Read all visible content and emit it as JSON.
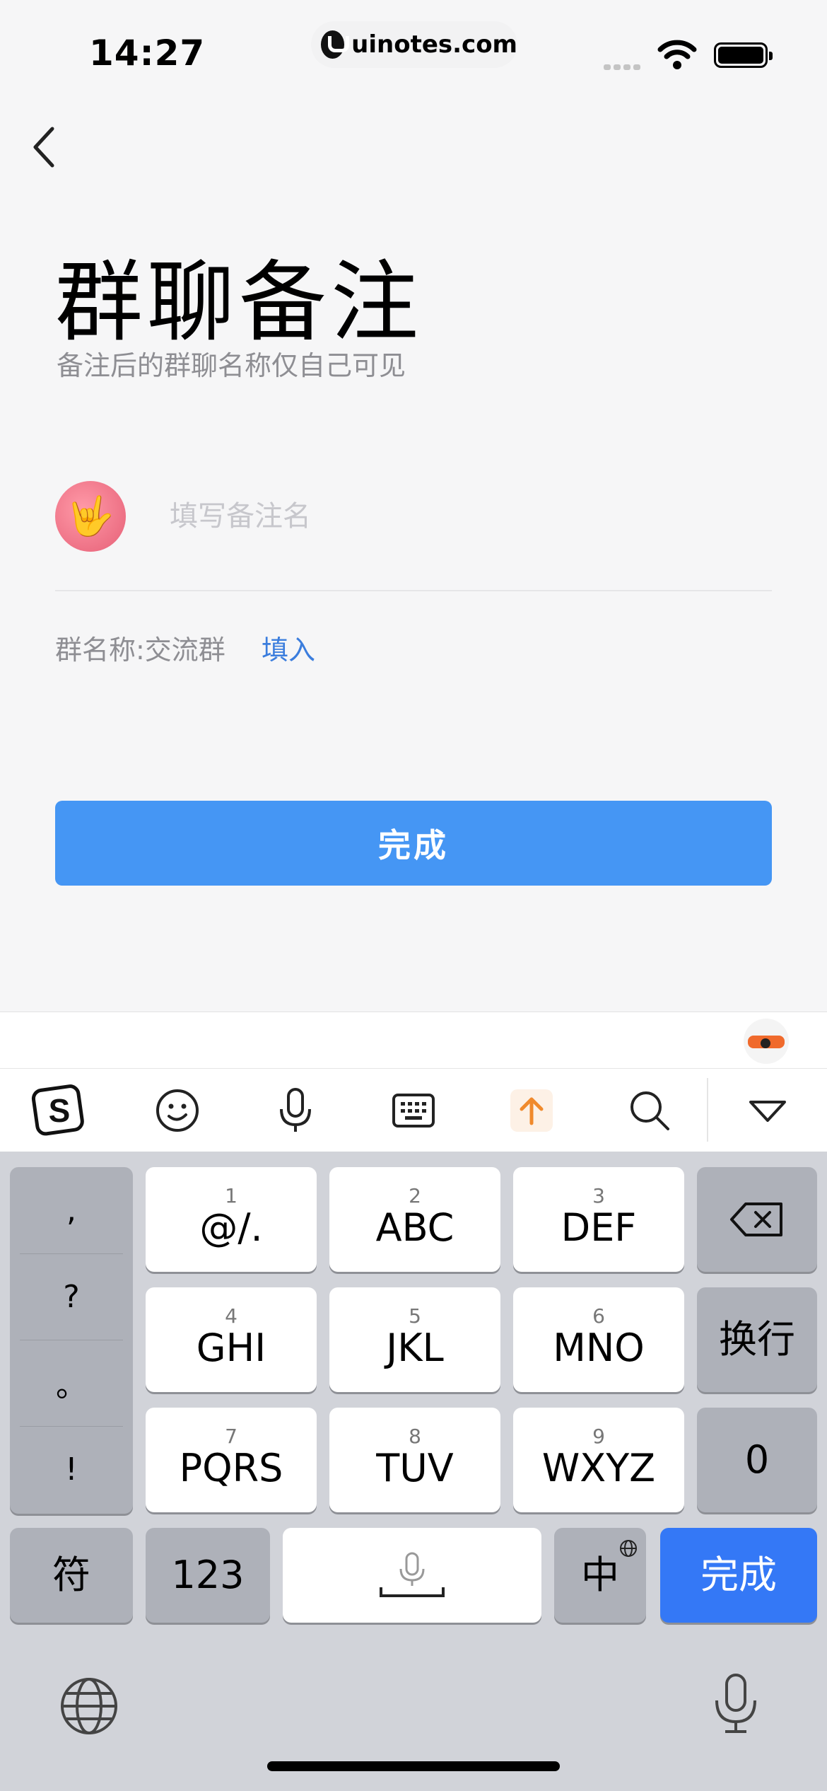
{
  "status_bar": {
    "time": "14:27",
    "site": "uinotes.com"
  },
  "page": {
    "title": "群聊备注",
    "subtitle": "备注后的群聊名称仅自己可见",
    "input_placeholder": "填写备注名",
    "input_value": "",
    "group_name_label": "群名称:交流群",
    "fill_in_link": "填入",
    "done_button": "完成",
    "accent_color": "#4596f4",
    "link_color": "#3b7ddd"
  },
  "keyboard": {
    "toolbar_icons": [
      "sogou-logo-icon",
      "emoji-icon",
      "microphone-icon",
      "keyboard-icon",
      "arrow-up-icon",
      "search-icon",
      "collapse-keyboard-icon"
    ],
    "punctuation": [
      ",",
      "?",
      "。",
      "!"
    ],
    "keys": [
      {
        "num": "1",
        "label": "@/."
      },
      {
        "num": "2",
        "label": "ABC"
      },
      {
        "num": "3",
        "label": "DEF"
      },
      {
        "num": "4",
        "label": "GHI"
      },
      {
        "num": "5",
        "label": "JKL"
      },
      {
        "num": "6",
        "label": "MNO"
      },
      {
        "num": "7",
        "label": "PQRS"
      },
      {
        "num": "8",
        "label": "TUV"
      },
      {
        "num": "9",
        "label": "WXYZ"
      }
    ],
    "newline": "换行",
    "zero": "0",
    "symbols": "符",
    "numbers": "123",
    "chinese": "中",
    "done": "完成"
  }
}
